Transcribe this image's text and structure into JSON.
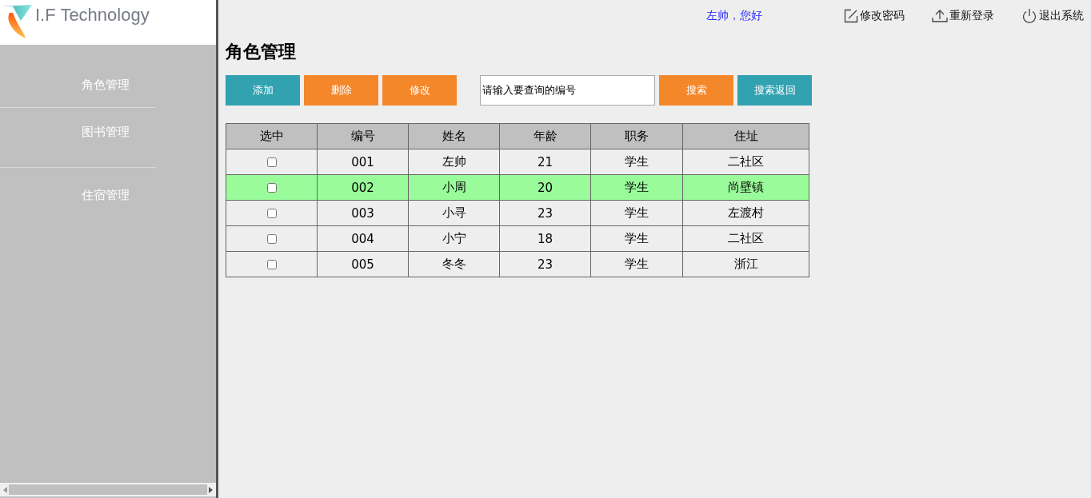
{
  "logo": {
    "text": "I.F Technology"
  },
  "sidebar": {
    "items": [
      {
        "label": "角色管理"
      },
      {
        "label": "图书管理"
      },
      {
        "label": "住宿管理"
      }
    ]
  },
  "header": {
    "greeting": "左帅，您好",
    "links": [
      {
        "label": "修改密码",
        "kind": "edit"
      },
      {
        "label": "重新登录",
        "kind": "upload"
      },
      {
        "label": "退出系统",
        "kind": "power"
      }
    ]
  },
  "page_title": "角色管理",
  "toolbar": {
    "buttons": [
      {
        "label": "添加",
        "kind": "teal"
      },
      {
        "label": "删除",
        "kind": "orange"
      },
      {
        "label": "修改",
        "kind": "orange"
      }
    ],
    "search": {
      "value": "请输入要查询的编号"
    },
    "search_buttons": [
      {
        "label": "搜索",
        "kind": "orange"
      },
      {
        "label": "搜索返回",
        "kind": "teal"
      }
    ]
  },
  "table": {
    "columns": [
      "选中",
      "编号",
      "姓名",
      "年龄",
      "职务",
      "住址"
    ],
    "rows": [
      {
        "highlighted": false,
        "cells": [
          {
            "kind": "checkbox",
            "checked": false
          },
          "001",
          "左帅",
          "21",
          "学生",
          "二社区"
        ]
      },
      {
        "highlighted": true,
        "cells": [
          {
            "kind": "checkbox",
            "checked": false
          },
          "002",
          "小周",
          "20",
          "学生",
          "尚壁镇"
        ]
      },
      {
        "highlighted": false,
        "cells": [
          {
            "kind": "checkbox",
            "checked": false
          },
          "003",
          "小寻",
          "23",
          "学生",
          "左渡村"
        ]
      },
      {
        "highlighted": false,
        "cells": [
          {
            "kind": "checkbox",
            "checked": false
          },
          "004",
          "小宁",
          "18",
          "学生",
          "二社区"
        ]
      },
      {
        "highlighted": false,
        "cells": [
          {
            "kind": "checkbox",
            "checked": false
          },
          "005",
          "冬冬",
          "23",
          "学生",
          "浙江"
        ]
      }
    ]
  }
}
